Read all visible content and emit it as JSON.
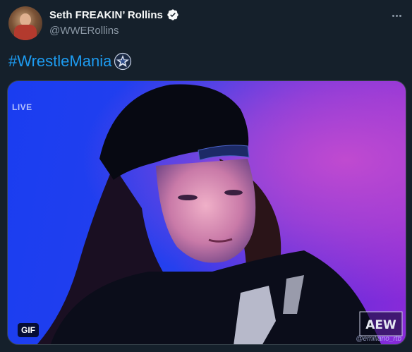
{
  "author": {
    "display_name": "Seth FREAKIN’ Rollins",
    "handle": "@WWERollins",
    "verified": true
  },
  "tweet": {
    "hashtag": "#WrestleMania",
    "emoji_icon": "wrestlemania-star-icon"
  },
  "media": {
    "overlay_text": "LIVE",
    "badge": "GIF",
    "logo_text": "AEW",
    "watermark": "@emiliano_rtb"
  },
  "colors": {
    "background": "#15202b",
    "link": "#1d9bf0",
    "secondary_text": "#8b98a5",
    "verified_badge": "#ffffff"
  }
}
